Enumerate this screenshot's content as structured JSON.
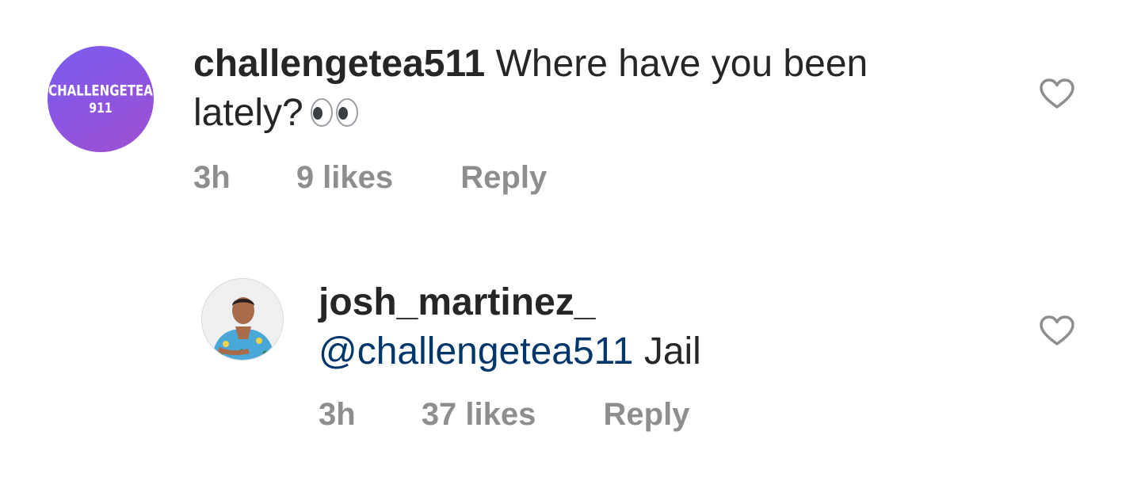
{
  "comments": [
    {
      "avatar": {
        "line1": "CHALLENGETEA",
        "line2": "911",
        "colors": [
          "#7b5cf0",
          "#9f4fd0"
        ]
      },
      "username": "challengetea511",
      "text_line1": " Where have you been",
      "text_line2": "lately?",
      "emoji": "eyes-icon",
      "time": "3h",
      "likes": "9 likes",
      "reply": "Reply"
    },
    {
      "avatar": {
        "type": "profile-photo"
      },
      "username": "josh_martinez_",
      "mention": "@challengetea511",
      "text": " Jail",
      "time": "3h",
      "likes": "37 likes",
      "reply": "Reply"
    }
  ],
  "colors": {
    "text": "#262626",
    "meta": "#8e8e8e",
    "mention": "#00376b",
    "heart": "#8e8e8e"
  }
}
